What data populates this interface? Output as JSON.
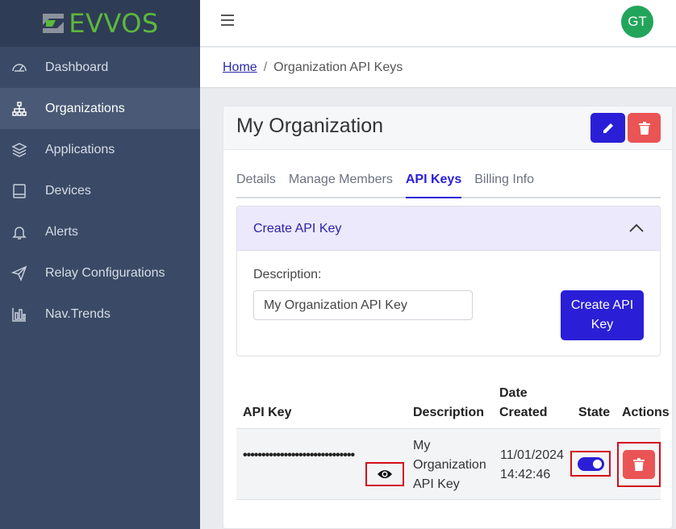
{
  "brand": {
    "name": "EVVOS",
    "color": "#5cb83d"
  },
  "sidebar": {
    "items": [
      {
        "label": "Dashboard",
        "icon": "speedometer-icon"
      },
      {
        "label": "Organizations",
        "icon": "hierarchy-icon",
        "active": true
      },
      {
        "label": "Applications",
        "icon": "layers-icon"
      },
      {
        "label": "Devices",
        "icon": "tablet-icon"
      },
      {
        "label": "Alerts",
        "icon": "bell-icon"
      },
      {
        "label": "Relay Configurations",
        "icon": "send-icon"
      },
      {
        "label": "Nav.Trends",
        "icon": "bar-chart-icon"
      }
    ]
  },
  "topbar": {
    "avatar_initials": "GT",
    "avatar_color": "#22a55b"
  },
  "breadcrumb": {
    "home": "Home",
    "separator": "/",
    "current": "Organization API Keys"
  },
  "card": {
    "title": "My Organization",
    "tabs": [
      {
        "label": "Details"
      },
      {
        "label": "Manage Members"
      },
      {
        "label": "API Keys",
        "active": true
      },
      {
        "label": "Billing Info"
      }
    ],
    "create_panel": {
      "title": "Create API Key",
      "description_label": "Description:",
      "description_value": "My Organization API Key",
      "create_button": "Create API Key"
    },
    "table": {
      "headers": {
        "api_key": "API Key",
        "description": "Description",
        "date_created": "Date Created",
        "state": "State",
        "actions": "Actions"
      },
      "rows": [
        {
          "api_key_masked": "••••••••••••••••••••••••••••••",
          "description": "My Organization API Key",
          "date": "11/01/2024",
          "time": "14:42:46",
          "state_enabled": true
        }
      ]
    }
  },
  "colors": {
    "primary": "#2a1fd6",
    "danger": "#ea5455",
    "sidebar": "#3a4a66",
    "highlight_box": "#d1101a"
  }
}
